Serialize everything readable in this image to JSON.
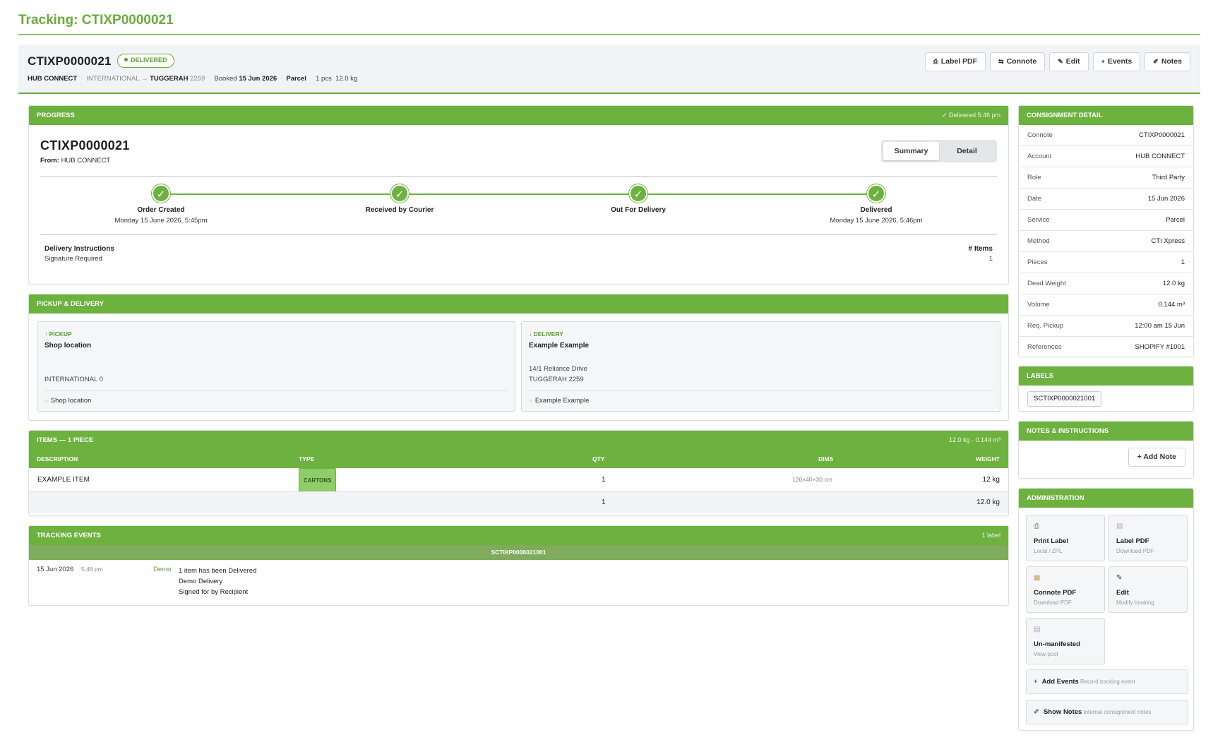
{
  "page": {
    "title": "Tracking: CTIXP0000021"
  },
  "summary": {
    "connote": "CTIXP0000021",
    "status": "DELIVERED",
    "account": "HUB CONNECT",
    "origin": "INTERNATIONAL",
    "arrow": "→",
    "dest_suburb": "TUGGERAH",
    "dest_postcode": "2259",
    "booked_label": "Booked",
    "booked_date": "15 Jun 2026",
    "service": "Parcel",
    "pieces": "1 pcs",
    "weight": "12.0 kg"
  },
  "actions": [
    {
      "icon": "⎙",
      "label": "Label PDF"
    },
    {
      "icon": "⇆",
      "label": "Connote"
    },
    {
      "icon": "✎",
      "label": "Edit"
    },
    {
      "icon": "+",
      "label": "Events"
    },
    {
      "icon": "✐",
      "label": "Notes"
    }
  ],
  "progress": {
    "header": "PROGRESS",
    "header_right": "✓ Delivered 5:46 pm",
    "connote": "CTIXP0000021",
    "from_label": "From:",
    "from_value": "HUB CONNECT",
    "toggle": [
      "Summary",
      "Detail"
    ],
    "steps": [
      {
        "check": "✓",
        "label": "Order Created",
        "date": "Monday 15 June 2026, 5:45pm"
      },
      {
        "check": "✓",
        "label": "Received by Courier",
        "date": ""
      },
      {
        "check": "✓",
        "label": "Out For Delivery",
        "date": ""
      },
      {
        "check": "✓",
        "label": "Delivered",
        "date": "Monday 15 June 2026, 5:46pm"
      }
    ],
    "delivery_instructions_label": "Delivery Instructions",
    "delivery_instructions_value": "Signature Required",
    "items_label": "# Items",
    "items_value": "1"
  },
  "pickup_delivery": {
    "header": "PICKUP & DELIVERY",
    "pickup": {
      "tag": "↑ PICKUP",
      "name": "Shop location",
      "line1": "INTERNATIONAL 0",
      "footer": "Shop location"
    },
    "delivery": {
      "tag": "↓ DELIVERY",
      "name": "Example Example",
      "line1": "14/1 Reliance Drive",
      "line2": "TUGGERAH 2259",
      "footer": "Example Example"
    }
  },
  "items": {
    "header": "ITEMS — 1 PIECE",
    "header_right": "12.0 kg · 0.144 m³",
    "columns": [
      "DESCRIPTION",
      "TYPE",
      "QTY",
      "DIMS",
      "WEIGHT"
    ],
    "rows": [
      {
        "description": "EXAMPLE ITEM",
        "type": "CARTONS",
        "qty": "1",
        "dims": "120×40×30 cm",
        "weight": "12 kg"
      }
    ],
    "total_qty": "1",
    "total_weight": "12.0 kg"
  },
  "tracking": {
    "header": "TRACKING EVENTS",
    "header_right": "1 label",
    "label_id": "SCTIXP0000021001",
    "events": [
      {
        "date": "15 Jun 2026",
        "time": "5:46 pm",
        "source": "Demo",
        "line1": "1 item has been Delivered",
        "line2": "Demo Delivery",
        "line3": "Signed for by Recipient"
      }
    ]
  },
  "consignment_detail": {
    "header": "CONSIGNMENT DETAIL",
    "rows": [
      {
        "k": "Connote",
        "v": "CTIXP0000021"
      },
      {
        "k": "Account",
        "v": "HUB CONNECT"
      },
      {
        "k": "Role",
        "v": "Third Party"
      },
      {
        "k": "Date",
        "v": "15 Jun 2026"
      },
      {
        "k": "Service",
        "v": "Parcel"
      },
      {
        "k": "Method",
        "v": "CTI Xpress"
      },
      {
        "k": "Pieces",
        "v": "1"
      },
      {
        "k": "Dead Weight",
        "v": "12.0 kg"
      },
      {
        "k": "Volume",
        "v": "0.144 m³"
      },
      {
        "k": "Req. Pickup",
        "v": "12:00 am 15 Jun"
      },
      {
        "k": "References",
        "v": "SHOPIFY #1001"
      }
    ]
  },
  "labels": {
    "header": "LABELS",
    "items": [
      "SCTIXP0000021001"
    ]
  },
  "notes": {
    "header": "NOTES & INSTRUCTIONS",
    "add_label": "+ Add Note"
  },
  "admin": {
    "header": "ADMINISTRATION",
    "tiles": [
      {
        "icon": "⎙",
        "title": "Print Label",
        "sub": "Local / ZPL"
      },
      {
        "icon": "▤",
        "title": "Label PDF",
        "sub": "Download PDF"
      },
      {
        "icon": "▦",
        "title": "Connote PDF",
        "sub": "Download PDF"
      },
      {
        "icon": "✎",
        "title": "Edit",
        "sub": "Modify booking"
      },
      {
        "icon": "▤",
        "title": "Un-manifested",
        "sub": "View pool"
      }
    ],
    "bars": [
      {
        "icon": "+",
        "title": "Add Events",
        "sub": "Record tracking event"
      },
      {
        "icon": "✐",
        "title": "Show Notes",
        "sub": "Internal consignment notes"
      }
    ]
  },
  "colors": {
    "accent": "#6db23f",
    "accent_dark": "#5a9e2c",
    "subhead": "#7eac5c",
    "bar_bg": "#f2f3f6"
  }
}
